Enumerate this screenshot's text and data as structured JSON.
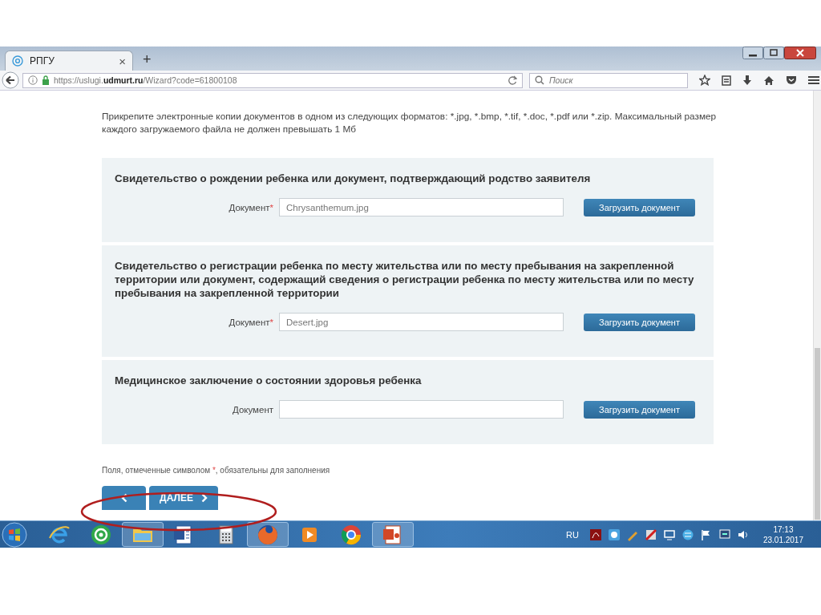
{
  "browser": {
    "tab": {
      "title": "РПГУ",
      "close": "×",
      "selected": true
    },
    "new_tab": "+",
    "address": "https://uslugi.**udmurt.ru**/Wizard?code=61800108",
    "search": {
      "placeholder": "Поиск"
    }
  },
  "page": {
    "intro": "Прикрепите электронные копии документов в одном из следующих форматов: *.jpg, *.bmp, *.tif, *.doc, *.pdf или *.zip. Максимальный размер каждого загружаемого файла не должен превышать 1 Мб",
    "sections": [
      {
        "title": "Свидетельство о рождении ребенка или документ, подтверждающий родство заявителя",
        "field": {
          "label": "Документ",
          "required_mark": "*",
          "value": "Chrysanthemum.jpg"
        },
        "button": "Загрузить документ"
      },
      {
        "title": "Свидетельство о регистрации ребенка по месту жительства или по месту пребывания на закрепленной территории или документ, содержащий сведения о регистрации ребенка по месту жительства или по месту пребывания на закрепленной территории",
        "field": {
          "label": "Документ",
          "required_mark": "*",
          "value": "Desert.jpg"
        },
        "button": "Загрузить документ"
      },
      {
        "title": "Медицинское заключение о состоянии здоровья ребенка",
        "field": {
          "label": "Документ"
        },
        "button": "Загрузить документ"
      }
    ],
    "note": {
      "before": "Поля, отмеченные символом ",
      "mark": "*",
      "after": ", обязательны для заполнения"
    },
    "next_button": "ДАЛЕЕ"
  },
  "taskbar": {
    "apps": [
      {
        "kind": "ie",
        "running": false
      },
      {
        "kind": "mail",
        "running": false
      },
      {
        "kind": "folder",
        "running": true
      },
      {
        "kind": "word",
        "running": false
      },
      {
        "kind": "calculator",
        "running": false
      },
      {
        "kind": "firefox",
        "running": true
      },
      {
        "kind": "media",
        "running": false
      },
      {
        "kind": "chrome",
        "running": false
      },
      {
        "kind": "powerpoint",
        "running": true
      }
    ],
    "language": "RU",
    "time": "17:13",
    "date": "23.01.2017"
  }
}
